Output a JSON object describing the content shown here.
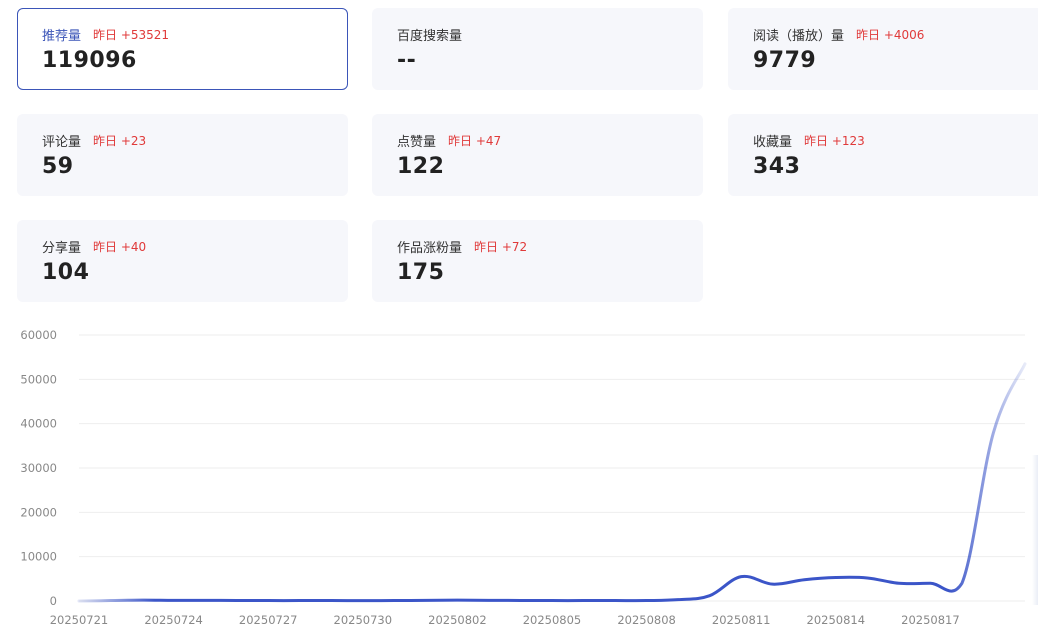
{
  "cards": [
    {
      "label": "推荐量",
      "delta": "昨日 +53521",
      "value": "119096"
    },
    {
      "label": "百度搜索量",
      "delta": "",
      "value": "--"
    },
    {
      "label": "阅读（播放）量",
      "delta": "昨日 +4006",
      "value": "9779"
    },
    {
      "label": "评论量",
      "delta": "昨日 +23",
      "value": "59"
    },
    {
      "label": "点赞量",
      "delta": "昨日 +47",
      "value": "122"
    },
    {
      "label": "收藏量",
      "delta": "昨日 +123",
      "value": "343"
    },
    {
      "label": "分享量",
      "delta": "昨日 +40",
      "value": "104"
    },
    {
      "label": "作品涨粉量",
      "delta": "昨日 +72",
      "value": "175"
    }
  ],
  "colors": {
    "accent": "#3b55b8",
    "delta": "#e03a3a",
    "line": "#3b55c8"
  },
  "chart_data": {
    "type": "line",
    "title": "",
    "xlabel": "",
    "ylabel": "",
    "ylim": [
      0,
      60000
    ],
    "yticks": [
      "60000",
      "50000",
      "40000",
      "30000",
      "20000",
      "10000",
      "0"
    ],
    "xticks": [
      "20250721",
      "20250724",
      "20250727",
      "20250730",
      "20250802",
      "20250805",
      "20250808",
      "20250811",
      "20250814",
      "20250817"
    ],
    "grid": true,
    "legend": "none",
    "x": [
      "20250721",
      "20250722",
      "20250723",
      "20250724",
      "20250725",
      "20250726",
      "20250727",
      "20250728",
      "20250729",
      "20250730",
      "20250731",
      "20250801",
      "20250802",
      "20250803",
      "20250804",
      "20250805",
      "20250806",
      "20250807",
      "20250808",
      "20250809",
      "20250810",
      "20250811",
      "20250812",
      "20250813",
      "20250814",
      "20250815",
      "20250816",
      "20250817",
      "20250818",
      "20250819",
      "20250820"
    ],
    "series": [
      {
        "values": [
          0,
          100,
          200,
          150,
          150,
          120,
          100,
          100,
          100,
          80,
          100,
          150,
          200,
          150,
          120,
          100,
          100,
          100,
          100,
          300,
          1200,
          5500,
          3800,
          4800,
          5300,
          5200,
          4000,
          4000,
          4000,
          38000,
          53500
        ]
      }
    ]
  }
}
